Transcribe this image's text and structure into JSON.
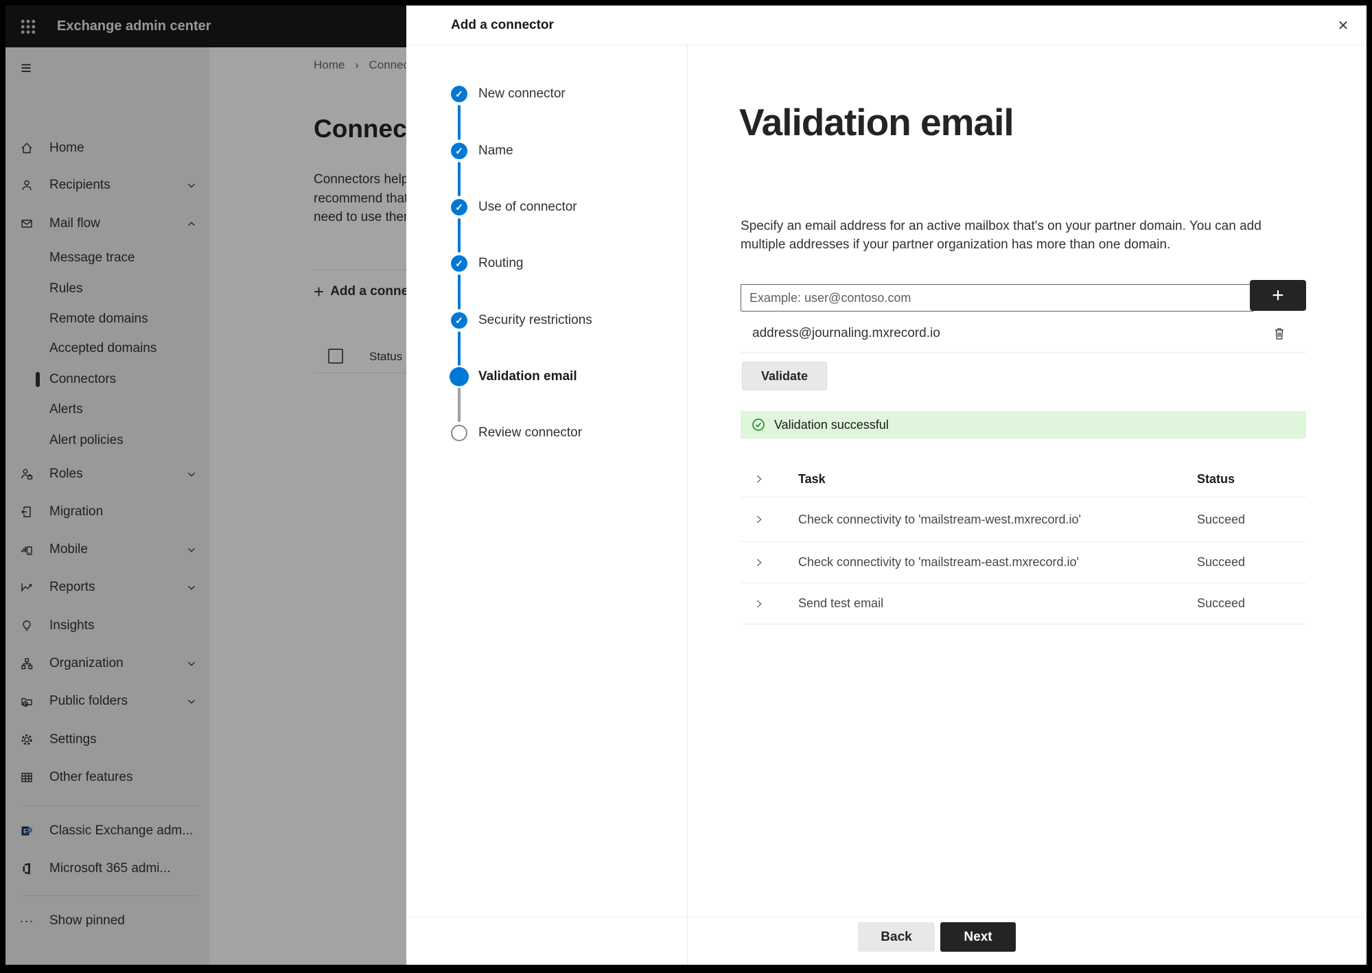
{
  "topbar": {
    "title": "Exchange admin center"
  },
  "icons": {
    "hamburger": "≡",
    "close": "✕",
    "plus": "+",
    "check": "✓",
    "breadcrumb_sep": "›",
    "ellipsis": "···"
  },
  "sidebar": {
    "items": [
      {
        "label": "Home"
      },
      {
        "label": "Recipients"
      },
      {
        "label": "Mail flow"
      },
      {
        "label": "Message trace"
      },
      {
        "label": "Rules"
      },
      {
        "label": "Remote domains"
      },
      {
        "label": "Accepted domains"
      },
      {
        "label": "Connectors",
        "selected": true
      },
      {
        "label": "Alerts"
      },
      {
        "label": "Alert policies"
      },
      {
        "label": "Roles"
      },
      {
        "label": "Migration"
      },
      {
        "label": "Mobile"
      },
      {
        "label": "Reports"
      },
      {
        "label": "Insights"
      },
      {
        "label": "Organization"
      },
      {
        "label": "Public folders"
      },
      {
        "label": "Settings"
      },
      {
        "label": "Other features"
      },
      {
        "label": "Classic Exchange adm..."
      },
      {
        "label": "Microsoft 365 admi..."
      },
      {
        "label": "Show pinned"
      }
    ]
  },
  "background": {
    "breadcrumb": {
      "home": "Home",
      "current": "Connectors"
    },
    "heading": "Connectors",
    "lines": [
      "Connectors help",
      "recommend that",
      "need to use them"
    ],
    "add_label": "Add a connector",
    "status_header": "Status"
  },
  "dialog": {
    "title": "Add a connector",
    "steps": [
      {
        "label": "New connector",
        "state": "done"
      },
      {
        "label": "Name",
        "state": "done"
      },
      {
        "label": "Use of connector",
        "state": "done"
      },
      {
        "label": "Routing",
        "state": "done"
      },
      {
        "label": "Security restrictions",
        "state": "done"
      },
      {
        "label": "Validation email",
        "state": "current"
      },
      {
        "label": "Review connector",
        "state": "todo"
      }
    ],
    "content": {
      "heading": "Validation email",
      "description": "Specify an email address for an active mailbox that's on your partner domain. You can add multiple addresses if your partner organization has more than one domain.",
      "email_input": {
        "placeholder": "Example: user@contoso.com",
        "value": ""
      },
      "added_address": "address@journaling.mxrecord.io",
      "validate_label": "Validate",
      "banner_text": "Validation successful",
      "table": {
        "columns": [
          "Task",
          "Status"
        ],
        "rows": [
          {
            "task": "Check connectivity to 'mailstream-west.mxrecord.io'",
            "status": "Succeed"
          },
          {
            "task": "Check connectivity to 'mailstream-east.mxrecord.io'",
            "status": "Succeed"
          },
          {
            "task": "Send test email",
            "status": "Succeed"
          }
        ]
      }
    },
    "footer": {
      "back_label": "Back",
      "next_label": "Next"
    }
  },
  "colors": {
    "accent": "#0078d4",
    "topbar_bg": "#1b1a19",
    "success_bg": "#dff6dd",
    "success_green": "#107c10",
    "dark_button": "#252423"
  }
}
